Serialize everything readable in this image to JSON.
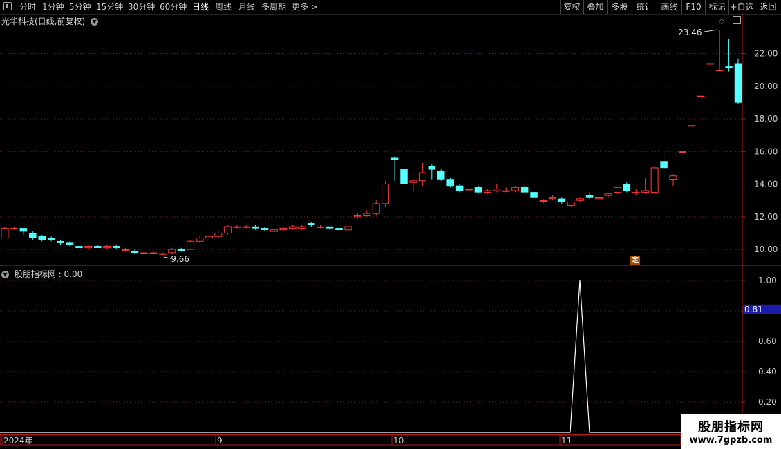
{
  "toolbar": {
    "periods": [
      {
        "label": "分时",
        "x": 28,
        "active": false
      },
      {
        "label": "1分钟",
        "x": 61,
        "active": false
      },
      {
        "label": "5分钟",
        "x": 100,
        "active": false
      },
      {
        "label": "15分钟",
        "x": 139,
        "active": false
      },
      {
        "label": "30分钟",
        "x": 185,
        "active": false
      },
      {
        "label": "60分钟",
        "x": 231,
        "active": false
      },
      {
        "label": "日线",
        "x": 278,
        "active": true
      },
      {
        "label": "周线",
        "x": 311,
        "active": false
      },
      {
        "label": "月线",
        "x": 345,
        "active": false
      },
      {
        "label": "多周期",
        "x": 378,
        "active": false
      },
      {
        "label": "更多 >",
        "x": 422,
        "active": false
      }
    ],
    "right_buttons": [
      "复权",
      "叠加",
      "多股",
      "统计",
      "画线",
      "F10",
      "标记",
      "+自选",
      "返回"
    ]
  },
  "main_chart": {
    "title": "光华科技(日线,前复权)",
    "high_label": "23.46",
    "low_label": "9.66",
    "ding_label": "定",
    "y_ticks": [
      "22.00",
      "20.00",
      "18.00",
      "16.00",
      "14.00",
      "12.00",
      "10.00"
    ]
  },
  "sub_chart": {
    "title": "股朋指标网 : 0.00",
    "current_value_label": "0.81",
    "y_ticks": [
      "1.00",
      "0.80",
      "0.60",
      "0.40",
      "0.20"
    ]
  },
  "x_axis": {
    "labels": [
      "2024年",
      "9",
      "10",
      "11"
    ]
  },
  "watermark": {
    "title": "股朋指标网",
    "url": "www.7gpzb.com"
  },
  "colors": {
    "up": "#ff3c3c",
    "down": "#54ffff",
    "grid": "#7a1a1a",
    "indicator_line": "#ffffff",
    "axis_border": "#b01c1c",
    "value_box": "#1c1ca8"
  },
  "chart_data": {
    "type": "candlestick",
    "ylim": [
      9.2,
      23.8
    ],
    "ohlc": [
      [
        10.7,
        11.4,
        10.7,
        11.3
      ],
      [
        11.3,
        11.4,
        11.2,
        11.3
      ],
      [
        11.3,
        11.3,
        10.9,
        11.1
      ],
      [
        11.0,
        11.1,
        10.6,
        10.7
      ],
      [
        10.8,
        10.9,
        10.5,
        10.6
      ],
      [
        10.7,
        10.8,
        10.5,
        10.6
      ],
      [
        10.5,
        10.6,
        10.3,
        10.4
      ],
      [
        10.4,
        10.5,
        10.2,
        10.3
      ],
      [
        10.2,
        10.3,
        10.0,
        10.1
      ],
      [
        10.1,
        10.3,
        10.0,
        10.2
      ],
      [
        10.2,
        10.3,
        10.1,
        10.1
      ],
      [
        10.1,
        10.3,
        10.0,
        10.2
      ],
      [
        10.2,
        10.3,
        10.0,
        10.1
      ],
      [
        10.0,
        10.1,
        9.9,
        10.0
      ],
      [
        9.9,
        10.0,
        9.7,
        9.8
      ],
      [
        9.8,
        9.9,
        9.7,
        9.8
      ],
      [
        9.8,
        9.9,
        9.7,
        9.8
      ],
      [
        9.7,
        9.8,
        9.66,
        9.75
      ],
      [
        9.8,
        10.1,
        9.7,
        10.0
      ],
      [
        10.0,
        10.1,
        9.9,
        9.9
      ],
      [
        10.0,
        10.6,
        10.0,
        10.5
      ],
      [
        10.5,
        10.8,
        10.4,
        10.7
      ],
      [
        10.7,
        10.9,
        10.6,
        10.8
      ],
      [
        10.8,
        11.1,
        10.7,
        11.0
      ],
      [
        11.0,
        11.5,
        10.9,
        11.4
      ],
      [
        11.4,
        11.5,
        11.3,
        11.4
      ],
      [
        11.4,
        11.5,
        11.3,
        11.4
      ],
      [
        11.4,
        11.5,
        11.2,
        11.3
      ],
      [
        11.3,
        11.4,
        11.1,
        11.2
      ],
      [
        11.1,
        11.2,
        11.0,
        11.2
      ],
      [
        11.2,
        11.4,
        11.1,
        11.3
      ],
      [
        11.3,
        11.5,
        11.3,
        11.4
      ],
      [
        11.3,
        11.5,
        11.2,
        11.4
      ],
      [
        11.6,
        11.7,
        11.4,
        11.5
      ],
      [
        11.4,
        11.5,
        11.3,
        11.4
      ],
      [
        11.4,
        11.4,
        11.2,
        11.3
      ],
      [
        11.3,
        11.4,
        11.2,
        11.2
      ],
      [
        11.2,
        11.4,
        11.2,
        11.4
      ],
      [
        12.0,
        12.2,
        11.9,
        12.1
      ],
      [
        12.1,
        12.4,
        12.0,
        12.2
      ],
      [
        12.2,
        13.0,
        12.1,
        12.8
      ],
      [
        12.8,
        14.2,
        12.6,
        14.0
      ],
      [
        15.6,
        15.7,
        14.2,
        15.5
      ],
      [
        14.9,
        15.3,
        13.9,
        14.0
      ],
      [
        14.1,
        14.3,
        13.6,
        14.2
      ],
      [
        14.2,
        15.3,
        13.9,
        14.7
      ],
      [
        15.1,
        15.2,
        14.3,
        14.9
      ],
      [
        14.8,
        14.9,
        14.2,
        14.3
      ],
      [
        14.3,
        14.4,
        13.8,
        13.9
      ],
      [
        13.9,
        14.0,
        13.5,
        13.6
      ],
      [
        13.7,
        13.8,
        13.5,
        13.7
      ],
      [
        13.8,
        13.9,
        13.4,
        13.5
      ],
      [
        13.5,
        13.7,
        13.4,
        13.6
      ],
      [
        13.6,
        14.0,
        13.5,
        13.7
      ],
      [
        13.6,
        13.8,
        13.5,
        13.6
      ],
      [
        13.6,
        13.9,
        13.5,
        13.8
      ],
      [
        13.8,
        13.9,
        13.5,
        13.5
      ],
      [
        13.5,
        13.6,
        13.1,
        13.2
      ],
      [
        13.0,
        13.1,
        12.8,
        13.0
      ],
      [
        13.1,
        13.3,
        13.0,
        13.2
      ],
      [
        13.1,
        13.2,
        12.8,
        12.9
      ],
      [
        12.7,
        12.9,
        12.6,
        12.9
      ],
      [
        13.0,
        13.2,
        12.9,
        13.1
      ],
      [
        13.3,
        13.5,
        13.1,
        13.2
      ],
      [
        13.1,
        13.3,
        13.0,
        13.2
      ],
      [
        13.3,
        13.4,
        13.2,
        13.4
      ],
      [
        13.5,
        13.8,
        13.4,
        13.8
      ],
      [
        14.0,
        14.1,
        13.5,
        13.6
      ],
      [
        13.5,
        13.7,
        13.3,
        13.5
      ],
      [
        13.5,
        14.4,
        13.4,
        13.6
      ],
      [
        13.5,
        15.1,
        13.4,
        15.0
      ],
      [
        15.4,
        16.1,
        14.3,
        15.0
      ],
      [
        14.3,
        14.6,
        13.9,
        14.5
      ],
      [
        16.0,
        16.0,
        16.0,
        16.0
      ],
      [
        17.6,
        17.6,
        17.6,
        17.6
      ],
      [
        19.4,
        19.4,
        19.4,
        19.4
      ],
      [
        21.4,
        21.4,
        21.4,
        21.4
      ],
      [
        21.0,
        23.46,
        21.0,
        21.0
      ],
      [
        21.2,
        22.9,
        20.9,
        21.1
      ],
      [
        21.4,
        21.7,
        18.9,
        19.0
      ]
    ],
    "indicator": {
      "values_note": "spike to 1.00 near 11 month, otherwise 0",
      "ylim": [
        0,
        1.05
      ],
      "spike_index": 61,
      "spike_value": 1.0
    }
  }
}
